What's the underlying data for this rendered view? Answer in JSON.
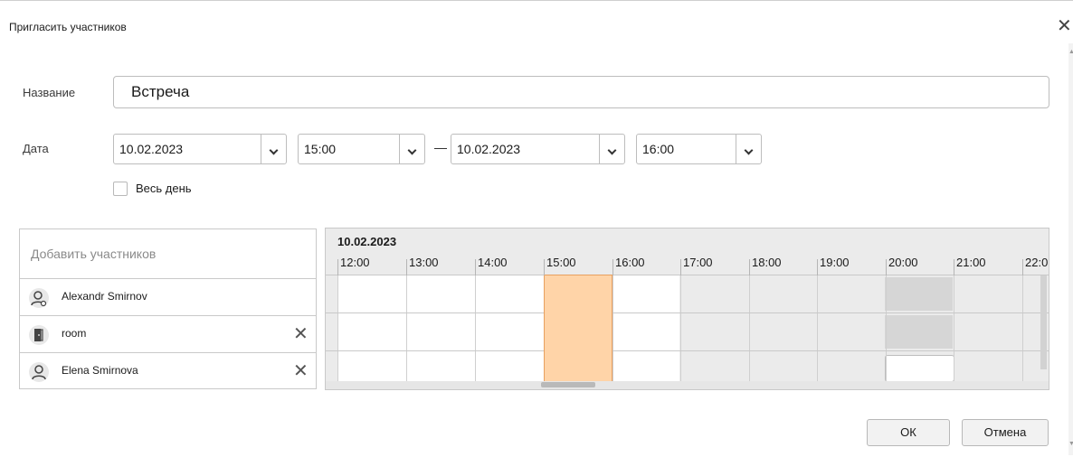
{
  "dialog": {
    "title": "Пригласить участников",
    "close_glyph": "✕"
  },
  "form": {
    "name_label": "Название",
    "name_value": "Встреча",
    "date_label": "Дата",
    "start_date": "10.02.2023",
    "start_time": "15:00",
    "end_date": "10.02.2023",
    "end_time": "16:00",
    "all_day_label": "Весь день",
    "all_day_checked": false
  },
  "participants": {
    "add_placeholder": "Добавить участников",
    "items": [
      {
        "name": "Alexandr Smirnov",
        "icon": "user-icon",
        "removable": false
      },
      {
        "name": "room",
        "icon": "door-icon",
        "removable": true
      },
      {
        "name": "Elena Smirnova",
        "icon": "user-icon",
        "removable": true
      }
    ],
    "remove_glyph": "✕"
  },
  "schedule": {
    "date": "10.02.2023",
    "hours": [
      "12:00",
      "13:00",
      "14:00",
      "15:00",
      "16:00",
      "17:00",
      "18:00",
      "19:00",
      "20:00",
      "21:00",
      "22:0"
    ],
    "selected_range": [
      "15:00",
      "16:00"
    ],
    "colors": {
      "selection": "#ffd4a8",
      "selection_border": "#e8a060",
      "busy": "#d6d6d6",
      "free": "#ffffff",
      "off_hours": "#ebebeb"
    }
  },
  "footer": {
    "ok_label": "ОК",
    "cancel_label": "Отмена"
  }
}
